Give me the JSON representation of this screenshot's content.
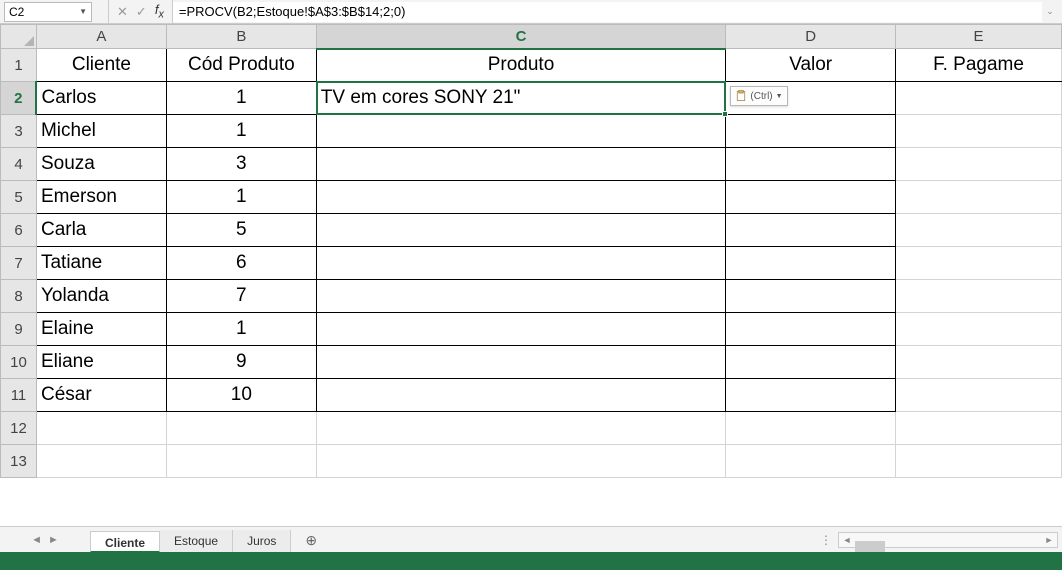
{
  "name_box": "C2",
  "formula": "=PROCV(B2;Estoque!$A$3:$B$14;2;0)",
  "paste_tag_label": "(Ctrl)",
  "columns": [
    "A",
    "B",
    "C",
    "D",
    "E"
  ],
  "selected_col": "C",
  "selected_row": 2,
  "headers": {
    "A": "Cliente",
    "B": "Cód Produto",
    "C": "Produto",
    "D": "Valor",
    "E": "F. Pagame"
  },
  "rows": [
    {
      "r": 2,
      "cliente": "Carlos",
      "cod": "1",
      "produto": "TV em cores SONY 21\""
    },
    {
      "r": 3,
      "cliente": "Michel",
      "cod": "1",
      "produto": ""
    },
    {
      "r": 4,
      "cliente": "Souza",
      "cod": "3",
      "produto": ""
    },
    {
      "r": 5,
      "cliente": "Emerson",
      "cod": "1",
      "produto": ""
    },
    {
      "r": 6,
      "cliente": "Carla",
      "cod": "5",
      "produto": ""
    },
    {
      "r": 7,
      "cliente": "Tatiane",
      "cod": "6",
      "produto": ""
    },
    {
      "r": 8,
      "cliente": "Yolanda",
      "cod": "7",
      "produto": ""
    },
    {
      "r": 9,
      "cliente": "Elaine",
      "cod": "1",
      "produto": ""
    },
    {
      "r": 10,
      "cliente": "Eliane",
      "cod": "9",
      "produto": ""
    },
    {
      "r": 11,
      "cliente": "César",
      "cod": "10",
      "produto": ""
    }
  ],
  "empty_rows": [
    12,
    13
  ],
  "tabs": [
    {
      "label": "Cliente",
      "active": true
    },
    {
      "label": "Estoque",
      "active": false
    },
    {
      "label": "Juros",
      "active": false
    }
  ],
  "chart_data": null
}
